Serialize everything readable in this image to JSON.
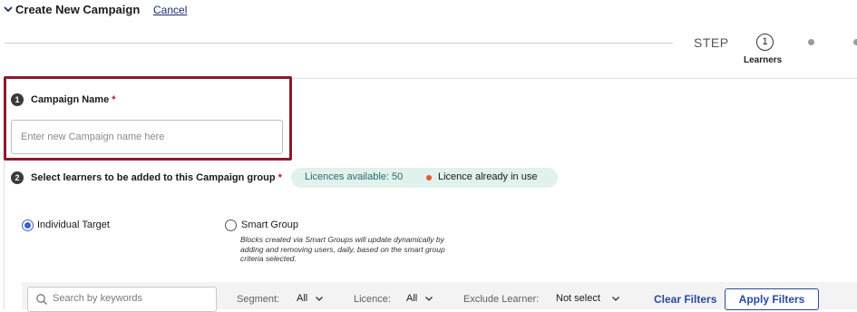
{
  "header": {
    "title": "Create New Campaign",
    "cancel_label": "Cancel"
  },
  "stepper": {
    "step_label": "STEP",
    "current_step": "1",
    "current_caption": "Learners"
  },
  "section1": {
    "number": "1",
    "label": "Campaign Name",
    "required_mark": "*",
    "input_placeholder": "Enter new Campaign name here",
    "input_value": ""
  },
  "section2": {
    "number": "2",
    "label": "Select learners to be added to this Campaign group",
    "required_mark": "*",
    "licences_available": "Licences available: 50",
    "licence_in_use": "Licence already in use",
    "options": {
      "individual": "Individual Target",
      "smart_group": "Smart Group",
      "smart_group_note": "Blocks created via Smart Groups will update dynamically by adding and removing users, daily, based on the smart group criteria selected.",
      "selected": "Individual Target"
    }
  },
  "filters": {
    "search_placeholder": "Search by keywords",
    "segment_label": "Segment:",
    "segment_value": "All",
    "licence_label": "Licence:",
    "licence_value": "All",
    "exclude_label": "Exclude Learner:",
    "exclude_value": "Not select",
    "clear_label": "Clear Filters",
    "apply_label": "Apply Filters"
  },
  "colors": {
    "accent": "#2a4a9e",
    "highlight_border": "#8a1b2b",
    "required": "#c0152f",
    "pill_bg": "#e1f1ec",
    "in_use_dot": "#e05a2b"
  }
}
